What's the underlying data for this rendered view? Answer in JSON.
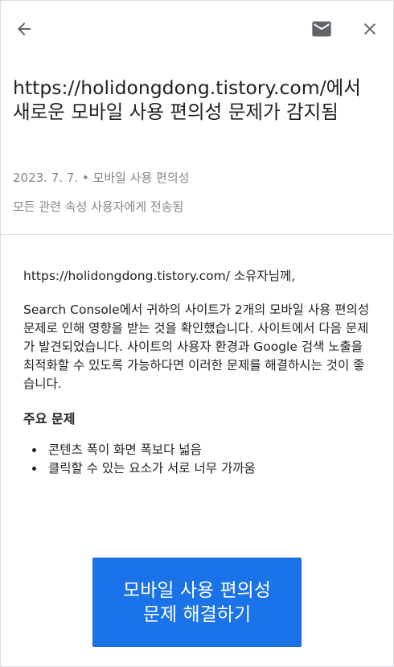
{
  "header": {
    "back_icon": "arrow-left-icon",
    "mail_icon": "envelope-icon",
    "close_icon": "close-icon",
    "icon_color": "#5f6368"
  },
  "message": {
    "title": "https://holidongdong.tistory.com/에서 새로운 모바일 사용 편의성 문제가 감지됨",
    "date_category": "2023. 7. 7. • 모바일 사용 편의성",
    "sent_to": "모든 관련 속성 사용자에게 전송됨"
  },
  "body": {
    "greeting": "https://holidongdong.tistory.com/ 소유자님께,",
    "paragraph": "Search Console에서 귀하의 사이트가 2개의 모바일 사용 편의성 문제로 인해 영향을 받는 것을 확인했습니다. 사이트에서 다음 문제가 발견되었습니다. 사이트의 사용자 환경과 Google 검색 노출을 최적화할 수 있도록 가능하다면 이러한 문제를 해결하시는 것이 좋습니다.",
    "issues_heading": "주요 문제",
    "issues": [
      "콘텐츠 폭이 화면 폭보다 넓음",
      "클릭할 수 있는 요소가 서로 너무 가까움"
    ]
  },
  "cta": {
    "line1": "모바일 사용 편의성",
    "line2": "문제 해결하기",
    "color": "#1a73e8"
  }
}
